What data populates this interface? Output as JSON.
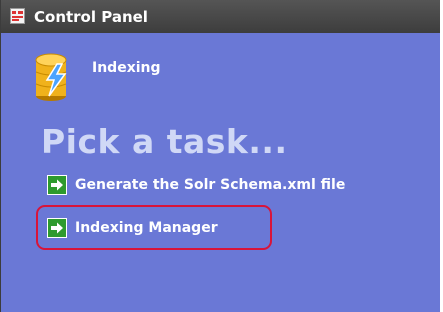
{
  "window": {
    "title": "Control Panel"
  },
  "panel": {
    "title": "Indexing",
    "icon": "database-lightning-icon"
  },
  "heading": "Pick a task...",
  "tasks": [
    {
      "label": "Generate the Solr Schema.xml file",
      "icon": "green-arrow-icon"
    },
    {
      "label": "Indexing Manager",
      "icon": "green-arrow-icon",
      "highlighted": true
    }
  ],
  "colors": {
    "background": "#6a78d6",
    "titlebar": "#444444",
    "heading": "#d0d8f6",
    "highlight": "#d8143a",
    "arrow": "#2e9a2e"
  }
}
